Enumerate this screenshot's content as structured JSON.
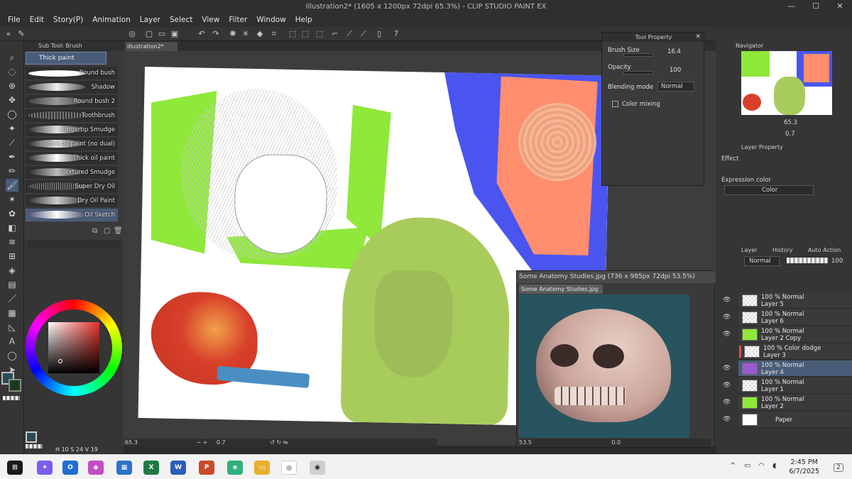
{
  "window": {
    "title": "Illustration2* (1605 x 1200px 72dpi 65.3%) - CLIP STUDIO PAINT EX",
    "min": "—",
    "max": "☐",
    "close": "✕"
  },
  "menu": [
    "File",
    "Edit",
    "Story(P)",
    "Animation",
    "Layer",
    "Select",
    "View",
    "Filter",
    "Window",
    "Help"
  ],
  "subtool": {
    "header": "Sub Tool: Brush",
    "selected_group": "Thick paint",
    "brushes": [
      "Round bush",
      "Shadow",
      "Round bush 2",
      "Toothbrush",
      "Fingertip Smudge",
      "Thick oil paint (no dual)",
      "Thick oil paint",
      "Textured Smudge",
      "Super Dry Oil",
      "Dry Oil Paint",
      "Oil Sketch"
    ],
    "selected_brush": "Oil Sketch"
  },
  "canvas": {
    "tab": "Illustration2*",
    "zoom": "65.3",
    "rotate": "0.7"
  },
  "tool_property": {
    "title": "Tool Property",
    "brush_size_label": "Brush Size",
    "brush_size": "16.4",
    "opacity_label": "Opacity",
    "opacity": "100",
    "blending_label": "Blending mode",
    "blending": "Normal",
    "color_mixing_label": "Color mixing"
  },
  "navigator": {
    "title": "Navigator",
    "zoom": "65.3",
    "rotate": "0.7"
  },
  "layer_property": {
    "title": "Layer Property",
    "effect_label": "Effect",
    "expression_label": "Expression color",
    "expression_value": "Color"
  },
  "layer_panel": {
    "tabs": [
      "Layer",
      "History",
      "Auto Action"
    ],
    "blend": "Normal",
    "opacity": "100",
    "layers": [
      {
        "mode": "100 % Normal",
        "name": "Layer 5"
      },
      {
        "mode": "100 % Normal",
        "name": "Layer 6"
      },
      {
        "mode": "100 % Normal",
        "name": "Layer 2 Copy"
      },
      {
        "mode": "100 % Color dodge",
        "name": "Layer 3"
      },
      {
        "mode": "100 % Normal",
        "name": "Layer 4"
      },
      {
        "mode": "100 % Normal",
        "name": "Layer 1"
      },
      {
        "mode": "100 % Normal",
        "name": "Layer 2"
      },
      {
        "mode": "",
        "name": "Paper"
      }
    ],
    "selected_layer": "Layer 4"
  },
  "subwindow": {
    "title": "Some Anatomy Studies.jpg (736 x 985px 72dpi 53.5%)",
    "tab": "Some Anatomy Studies.jpg",
    "zoom": "53.5",
    "rotate": "0.0"
  },
  "color_status": {
    "h": "H",
    "h_val": "10",
    "s": "S",
    "s_val": "24",
    "v": "V",
    "v_val": "19"
  },
  "taskbar": {
    "time": "2:45 PM",
    "date": "6/7/2025",
    "notif": "2"
  },
  "colors": {
    "accent": "#4a5d78",
    "green": "#8fe83a",
    "blue": "#4a55f0",
    "salmon": "#ff8e6e"
  }
}
